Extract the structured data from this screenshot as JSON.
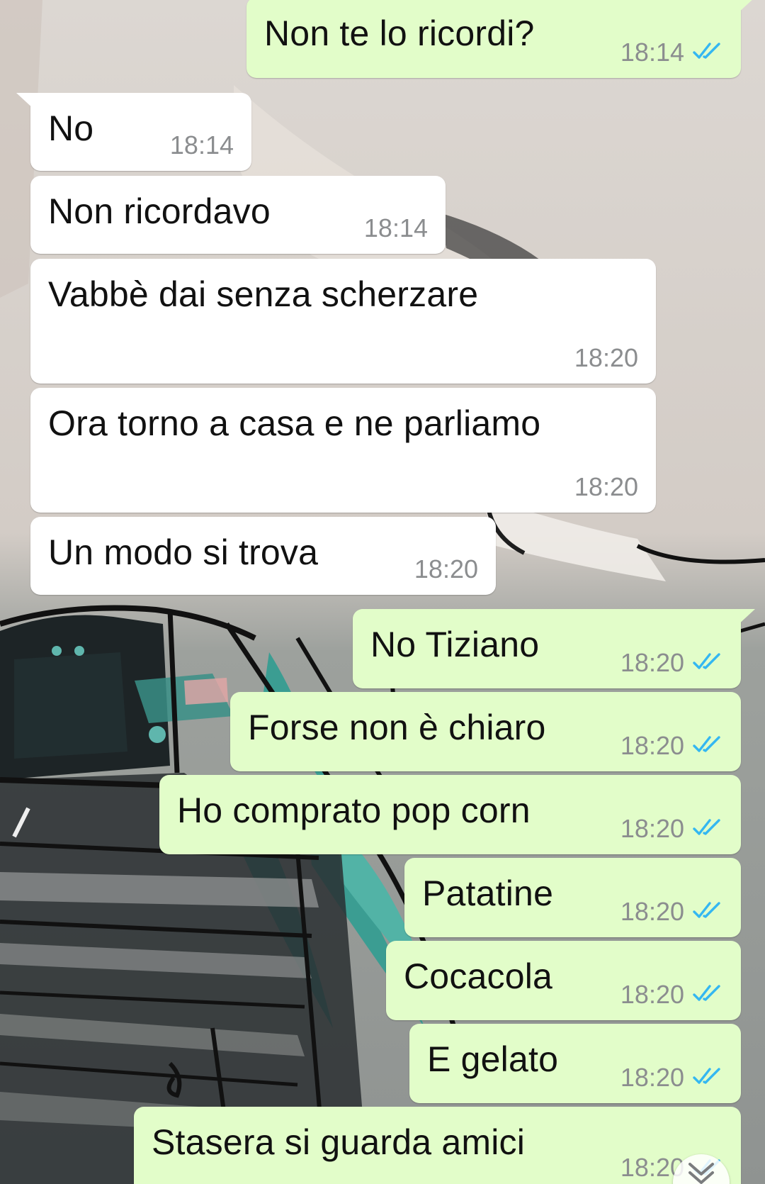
{
  "colors": {
    "incoming_bubble": "#ffffff",
    "outgoing_bubble": "#e2fdc9",
    "timestamp": "#8b8d8f",
    "read_ticks": "#34b7f1"
  },
  "messages": [
    {
      "direction": "outgoing",
      "text": "Non te lo ricordi?",
      "time": "18:14",
      "status": "read"
    },
    {
      "direction": "incoming",
      "text": "No",
      "time": "18:14"
    },
    {
      "direction": "incoming",
      "text": "Non ricordavo",
      "time": "18:14"
    },
    {
      "direction": "incoming",
      "text": "Vabbè dai senza scherzare",
      "time": "18:20"
    },
    {
      "direction": "incoming",
      "text": "Ora torno a casa e ne parliamo",
      "time": "18:20"
    },
    {
      "direction": "incoming",
      "text": "Un modo si trova",
      "time": "18:20"
    },
    {
      "direction": "outgoing",
      "text": "No Tiziano",
      "time": "18:20",
      "status": "read"
    },
    {
      "direction": "outgoing",
      "text": "Forse non è chiaro",
      "time": "18:20",
      "status": "read"
    },
    {
      "direction": "outgoing",
      "text": "Ho comprato pop corn",
      "time": "18:20",
      "status": "read"
    },
    {
      "direction": "outgoing",
      "text": "Patatine",
      "time": "18:20",
      "status": "read"
    },
    {
      "direction": "outgoing",
      "text": "Cocacola",
      "time": "18:20",
      "status": "read"
    },
    {
      "direction": "outgoing",
      "text": "E gelato",
      "time": "18:20",
      "status": "read"
    },
    {
      "direction": "outgoing",
      "text": "Stasera si guarda amici",
      "time": "18:20",
      "status": "read"
    }
  ],
  "scroll_button": {
    "icon": "chevron-down-icon"
  }
}
